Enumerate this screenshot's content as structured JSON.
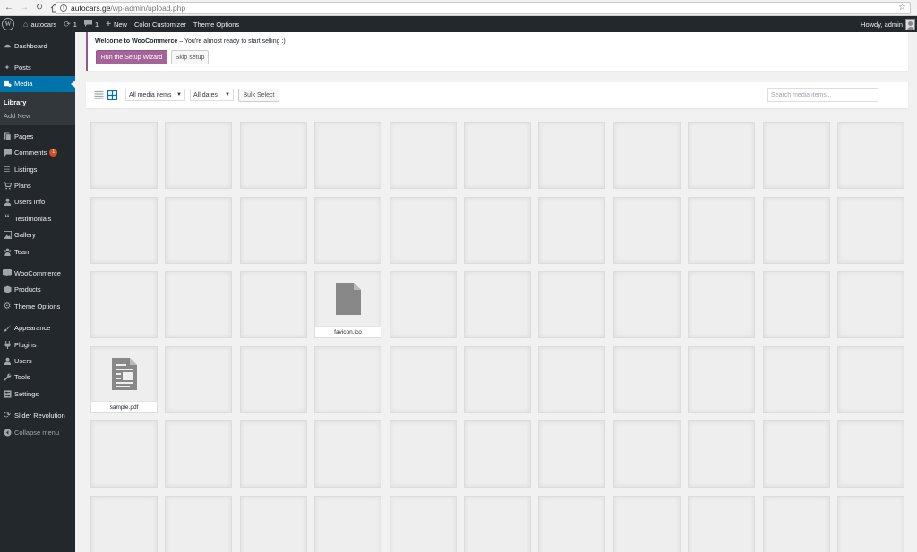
{
  "browser": {
    "url_host": "autocars.ge",
    "url_path": "/wp-admin/upload.php"
  },
  "adminbar": {
    "site_name": "autocars",
    "updates_count": "1",
    "comments_count": "1",
    "new_label": "New",
    "color_customizer": "Color Customizer",
    "theme_options": "Theme Options",
    "howdy": "Howdy, admin"
  },
  "sidebar": {
    "dashboard": "Dashboard",
    "posts": "Posts",
    "media": "Media",
    "library": "Library",
    "add_new": "Add New",
    "pages": "Pages",
    "comments": "Comments",
    "comments_badge": "1",
    "listings": "Listings",
    "plans": "Plans",
    "users_info": "Users Info",
    "testimonials": "Testimonials",
    "gallery": "Gallery",
    "team": "Team",
    "woocommerce": "WooCommerce",
    "products": "Products",
    "theme_options": "Theme Options",
    "appearance": "Appearance",
    "plugins": "Plugins",
    "users": "Users",
    "tools": "Tools",
    "settings": "Settings",
    "slider_revolution": "Slider Revolution",
    "collapse": "Collapse menu"
  },
  "notice": {
    "title": "Welcome to WooCommerce",
    "text": " – You're almost ready to start selling :)",
    "run_wizard": "Run the Setup Wizard",
    "skip": "Skip setup"
  },
  "toolbar": {
    "media_type": "All media items",
    "dates": "All dates",
    "bulk_select": "Bulk Select",
    "search_placeholder": "Search media items..."
  },
  "media_files": {
    "favicon": "favicon.ico",
    "sample": "sample.pdf"
  },
  "colors": {
    "admin_bg": "#23282d",
    "active_blue": "#0073aa",
    "woo_purple": "#a46497",
    "badge_red": "#d54e21"
  }
}
